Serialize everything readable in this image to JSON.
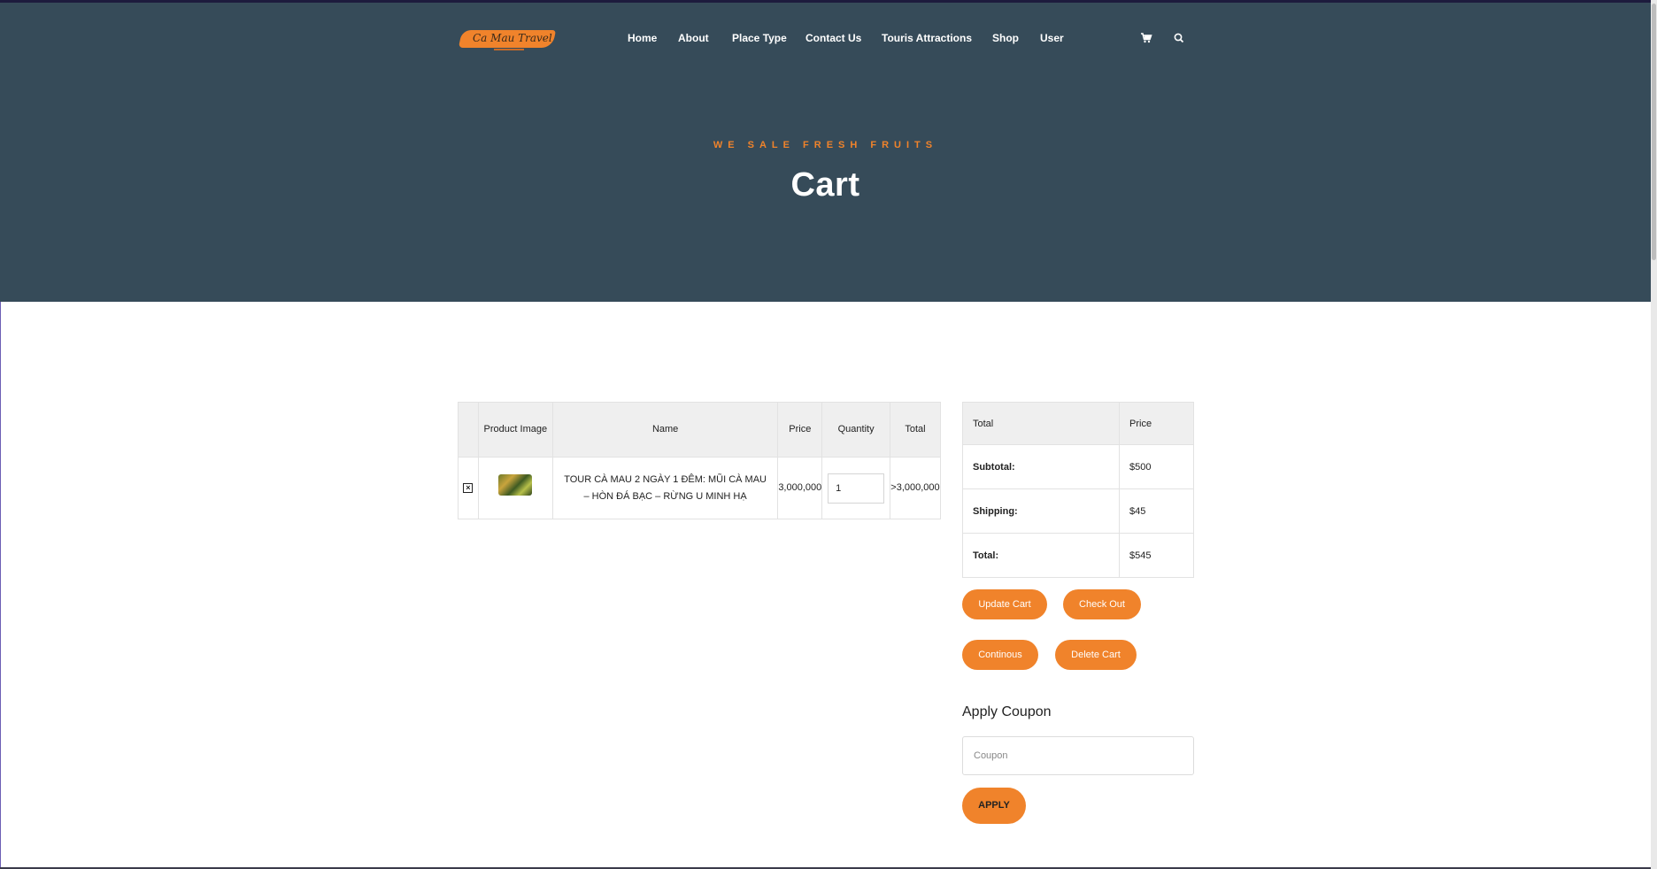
{
  "brand": {
    "logo_text": "Ca Mau Travel",
    "accent_color": "#f0832b",
    "hero_bg": "#364b59"
  },
  "nav": {
    "items": [
      "Home",
      "About",
      "Place Type",
      "Contact Us",
      "Touris Attractions",
      "Shop",
      "User"
    ],
    "icons": [
      "cart-icon",
      "search-icon"
    ]
  },
  "hero": {
    "subtitle": "WE SALE FRESH FRUITS",
    "title": "Cart"
  },
  "cart_table": {
    "headers": {
      "image": "Product Image",
      "name": "Name",
      "price": "Price",
      "quantity": "Quantity",
      "total": "Total"
    },
    "rows": [
      {
        "name": "TOUR CÀ MAU 2 NGÀY 1 ĐÊM: MŨI CÀ MAU – HÒN ĐÁ BẠC – RỪNG U MINH HẠ",
        "price": "3,000,000",
        "quantity": "1",
        "total": ">3,000,000"
      }
    ]
  },
  "totals": {
    "header_label": "Total",
    "header_price": "Price",
    "subtotal_label": "Subtotal:",
    "subtotal_value": "$500",
    "shipping_label": "Shipping:",
    "shipping_value": "$45",
    "total_label": "Total:",
    "total_value": "$545"
  },
  "actions": {
    "update": "Update Cart",
    "checkout": "Check Out",
    "continue": "Continous",
    "delete": "Delete Cart"
  },
  "coupon": {
    "title": "Apply Coupon",
    "placeholder": "Coupon",
    "apply": "APPLY"
  }
}
